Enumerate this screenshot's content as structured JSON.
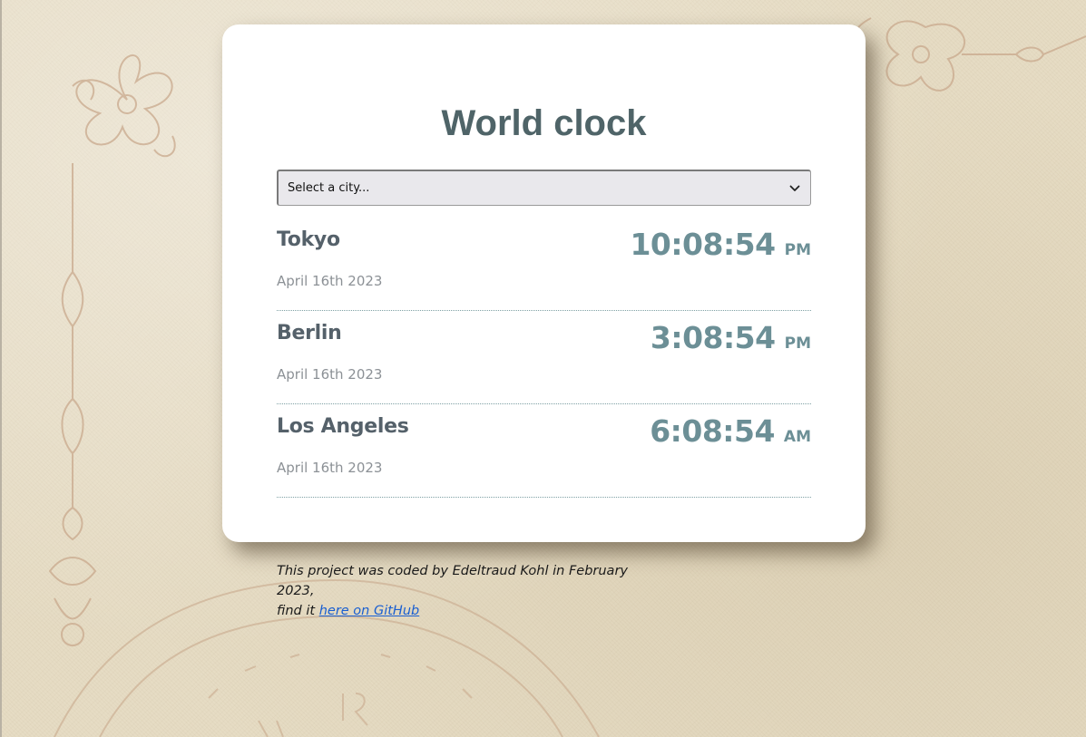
{
  "app": {
    "title": "World clock"
  },
  "select": {
    "selected_label": "Select a city..."
  },
  "cities": [
    {
      "name": "Tokyo",
      "date": "April 16th 2023",
      "time": "10:08:54",
      "ampm": "PM"
    },
    {
      "name": "Berlin",
      "date": "April 16th 2023",
      "time": "3:08:54",
      "ampm": "PM"
    },
    {
      "name": "Los Angeles",
      "date": "April 16th 2023",
      "time": "6:08:54",
      "ampm": "AM"
    }
  ],
  "footer": {
    "text_line1": "This project was coded by Edeltraud Kohl in February 2023,",
    "text_prefix": "find it ",
    "link_label": "here on GitHub"
  },
  "icons": {
    "select_chevron": "chevron-down-icon",
    "ornament": "ornament-decoration"
  },
  "colors": {
    "title": "#4f6468",
    "time": "#6c8f96",
    "city_name": "#55616a",
    "date": "#8c9196",
    "link": "#1a5fd1",
    "card_bg": "#ffffff",
    "page_bg": "#e6dcc4"
  }
}
